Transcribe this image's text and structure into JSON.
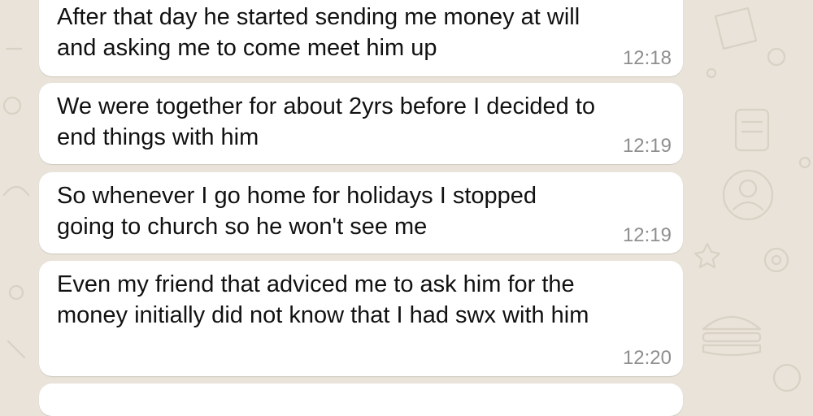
{
  "chat": {
    "messages": [
      {
        "text": "After that day he started sending me money at will\nand asking me to come meet him up",
        "time": "12:18"
      },
      {
        "text": "We were together for about 2yrs before I decided to\nend things with him",
        "time": "12:19"
      },
      {
        "text": "So whenever I go home for holidays I stopped\ngoing to church so he won't see me",
        "time": "12:19"
      },
      {
        "text": "Even my friend that adviced me to ask him for the\nmoney initially did not know that I had swx with him",
        "time": "12:20"
      }
    ]
  },
  "colors": {
    "background": "#e9e3d9",
    "bubble": "#ffffff",
    "timestamp": "#8f8f8f",
    "text": "#111111"
  }
}
